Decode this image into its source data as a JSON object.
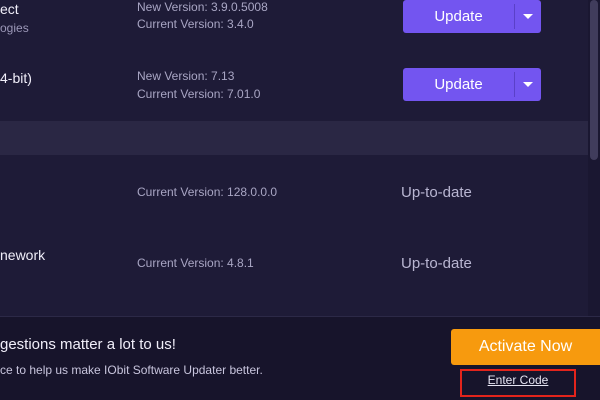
{
  "software_list": [
    {
      "name_line1": "ect",
      "name_line2": "ogies",
      "new_version": "New Version: 3.9.0.5008",
      "current_version": "Current Version: 3.4.0",
      "action_label": "Update"
    },
    {
      "name_line1": "4-bit)",
      "new_version": "New Version: 7.13",
      "current_version": "Current Version: 7.01.0",
      "action_label": "Update"
    },
    {
      "name_line1": "",
      "current_version": "Current Version: 128.0.0.0",
      "status": "Up-to-date"
    },
    {
      "name_line1": "nework",
      "current_version": "Current Version: 4.8.1",
      "status": "Up-to-date"
    }
  ],
  "footer": {
    "headline": "gestions matter a lot to us!",
    "subtext": "ce to help us make IObit Software Updater better.",
    "activate_label": "Activate Now",
    "enter_code_label": "Enter Code"
  },
  "colors": {
    "background": "#1e1b37",
    "update_button": "#7355f0",
    "activate_button": "#f79a0e",
    "highlight_box": "#e3241c"
  }
}
